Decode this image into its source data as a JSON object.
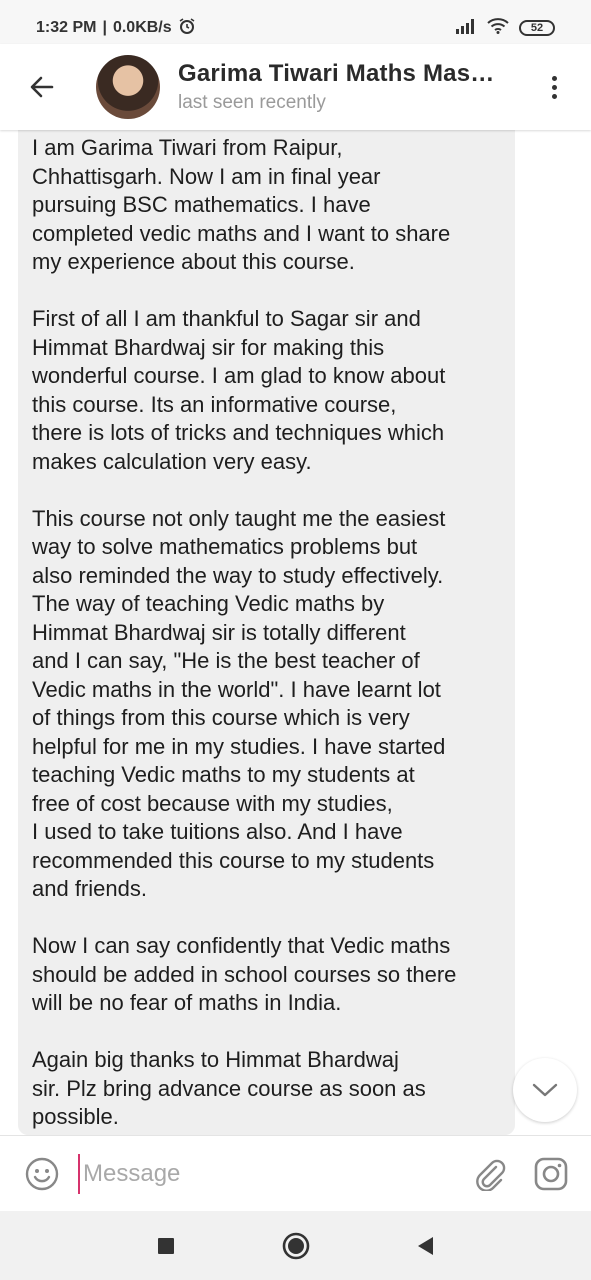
{
  "status_bar": {
    "time": "1:32 PM",
    "network_speed": "0.0KB/s",
    "battery": "52",
    "icons": [
      "alarm-icon",
      "signal-icon",
      "wifi-icon",
      "battery-icon"
    ]
  },
  "header": {
    "title": "Garima Tiwari Maths Mas…",
    "subtitle": "last seen recently",
    "icons": [
      "back-arrow-icon",
      "more-vertical-icon"
    ]
  },
  "chat": {
    "message": {
      "paragraphs": [
        "I am Garima Tiwari from Raipur,\nChhattisgarh. Now I am in final year\npursuing BSC mathematics. I have\ncompleted vedic maths  and I want to share\nmy experience about this course.",
        "First of all I am thankful to Sagar sir and\nHimmat Bhardwaj sir for making this\nwonderful course. I am glad to know about\nthis course. Its an informative course,\nthere is lots of tricks and techniques which\nmakes calculation very easy.",
        "This course not only taught me the easiest\nway to solve mathematics problems but\nalso reminded the way to study effectively.\nThe way of teaching Vedic maths by\nHimmat Bhardwaj sir is totally different\nand I can say, \"He is the best teacher of\nVedic maths in the world\". I have learnt lot\nof things from this course which is very\nhelpful for me in my studies. I have  started\nteaching Vedic maths to my students  at\nfree of cost because with my studies,\nI used to take tuitions also. And I have\nrecommended this course to my students\nand friends.",
        "Now I can say confidently that Vedic maths\nshould be added in school courses so there\nwill be no fear of maths in India.",
        "Again big thanks to Himmat Bhardwaj\nsir. Plz bring advance course as soon as\npossible."
      ]
    },
    "scroll_icon": "chevron-down-icon"
  },
  "input_bar": {
    "placeholder": "Message",
    "value": "",
    "icons": [
      "emoji-icon",
      "attach-icon",
      "camera-icon"
    ]
  },
  "nav_bar": {
    "icons": [
      "recents-icon",
      "home-icon",
      "back-triangle-icon"
    ]
  },
  "colors": {
    "bubble": "#efefef",
    "cursor": "#d6336c",
    "muted_text": "#9a9a9a"
  }
}
